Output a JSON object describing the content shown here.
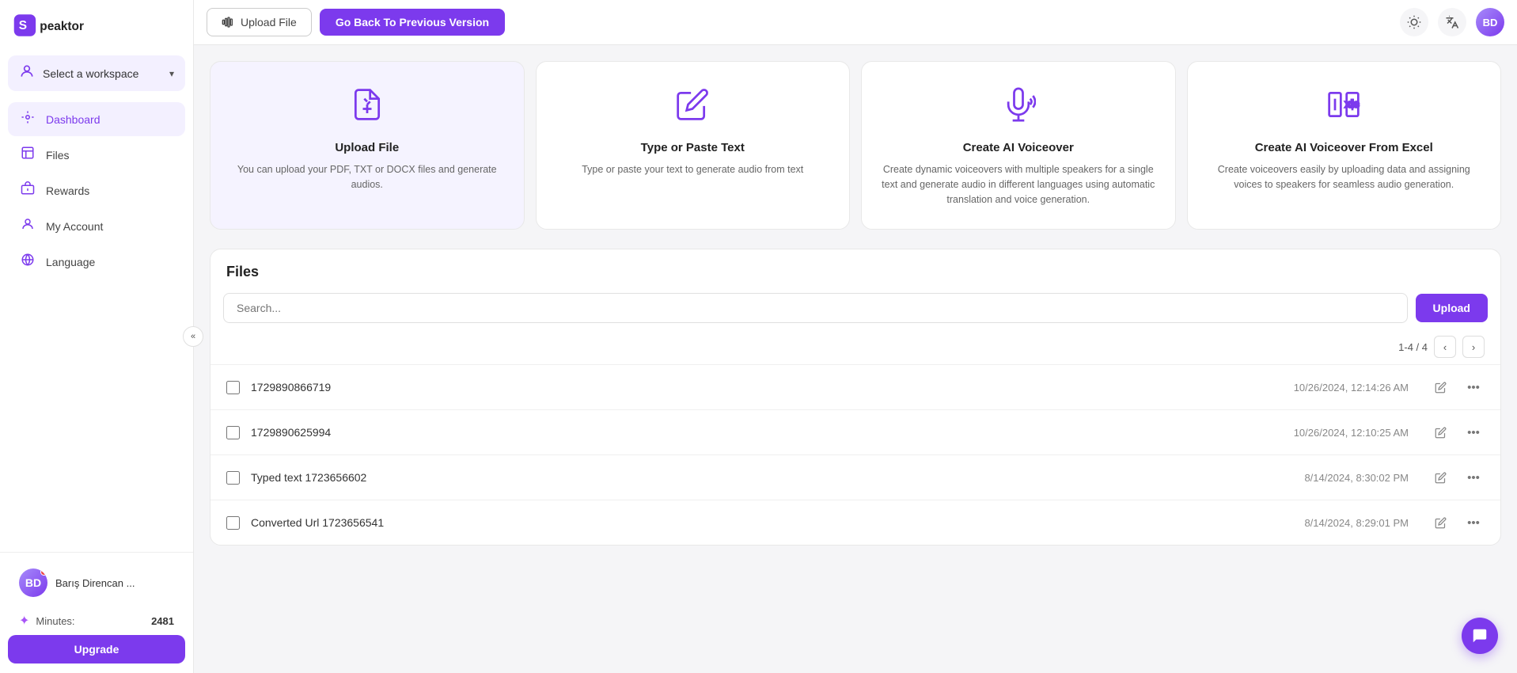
{
  "brand": {
    "name": "Speaktor"
  },
  "sidebar": {
    "workspace": {
      "label": "Select a workspace",
      "chevron": "▾"
    },
    "nav_items": [
      {
        "id": "dashboard",
        "label": "Dashboard",
        "icon": "dashboard",
        "active": true
      },
      {
        "id": "files",
        "label": "Files",
        "icon": "files",
        "active": false
      },
      {
        "id": "rewards",
        "label": "Rewards",
        "icon": "rewards",
        "active": false
      },
      {
        "id": "my-account",
        "label": "My Account",
        "icon": "account",
        "active": false
      },
      {
        "id": "language",
        "label": "Language",
        "icon": "language",
        "active": false
      }
    ],
    "user": {
      "name": "Barış Direncan ...",
      "minutes_label": "Minutes:",
      "minutes_value": "2481"
    },
    "upgrade_label": "Upgrade",
    "collapse_icon": "«"
  },
  "topbar": {
    "upload_file_label": "Upload File",
    "go_back_label": "Go Back To Previous Version",
    "theme_icon": "sun",
    "translate_icon": "translate"
  },
  "action_cards": [
    {
      "id": "upload-file",
      "title": "Upload File",
      "description": "You can upload your PDF, TXT or DOCX files and generate audios.",
      "highlighted": true
    },
    {
      "id": "type-paste",
      "title": "Type or Paste Text",
      "description": "Type or paste your text to generate audio from text",
      "highlighted": false
    },
    {
      "id": "ai-voiceover",
      "title": "Create AI Voiceover",
      "description": "Create dynamic voiceovers with multiple speakers for a single text and generate audio in different languages using automatic translation and voice generation.",
      "highlighted": false
    },
    {
      "id": "ai-voiceover-excel",
      "title": "Create AI Voiceover From Excel",
      "description": "Create voiceovers easily by uploading data and assigning voices to speakers for seamless audio generation.",
      "highlighted": false
    }
  ],
  "files_section": {
    "title": "Files",
    "search_placeholder": "Search...",
    "upload_label": "Upload",
    "pagination": "1-4 / 4",
    "files": [
      {
        "id": 1,
        "name": "1729890866719",
        "date": "10/26/2024, 12:14:26 AM"
      },
      {
        "id": 2,
        "name": "1729890625994",
        "date": "10/26/2024, 12:10:25 AM"
      },
      {
        "id": 3,
        "name": "Typed text 1723656602",
        "date": "8/14/2024, 8:30:02 PM"
      },
      {
        "id": 4,
        "name": "Converted Url 1723656541",
        "date": "8/14/2024, 8:29:01 PM"
      }
    ]
  },
  "colors": {
    "primary": "#7c3aed",
    "primary_light": "#f3f0ff",
    "accent": "#a855f7"
  }
}
